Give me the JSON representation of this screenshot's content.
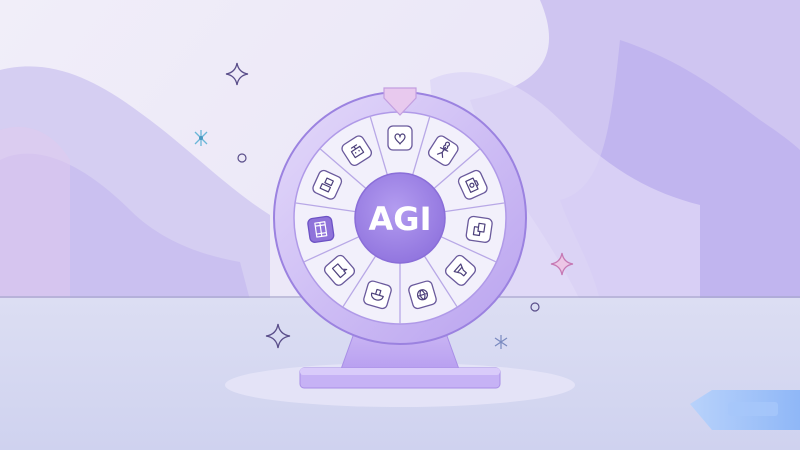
{
  "wheel": {
    "center_label": "AGI",
    "segment_icons": [
      "heart-icon",
      "figure-icon",
      "camera-icon",
      "swap-icon",
      "potion-icon",
      "globe-icon",
      "mushroom-icon",
      "chat-bubble-icon",
      "film-icon",
      "devices-icon",
      "robot-icon"
    ],
    "highlighted_segment_icon": "film-icon"
  },
  "colors": {
    "background": "#ecebf7",
    "accent": "#a48ae8",
    "wheel_rim": "#c8b8f2",
    "center_hub": "#9a7ee0",
    "center_text": "#ffffff",
    "pointer": "#e7c7ee",
    "ground": "#d5d7f0",
    "highlight_tile": "#8f73da"
  },
  "decorations": [
    "sparkle-icon",
    "sparkle-icon",
    "sparkle-icon",
    "sparkle-icon",
    "sparkle-icon",
    "circle-dot",
    "circle-dot"
  ]
}
